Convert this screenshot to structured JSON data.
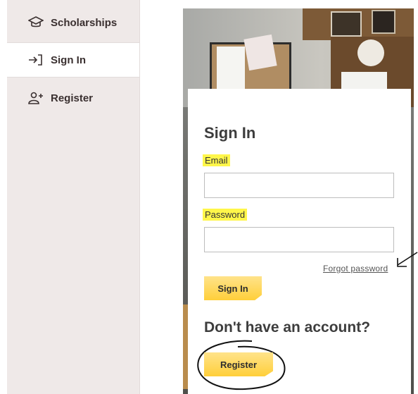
{
  "sidebar": {
    "items": [
      {
        "label": "Scholarships",
        "icon": "graduation-cap-icon"
      },
      {
        "label": "Sign In",
        "icon": "sign-in-icon",
        "active": true
      },
      {
        "label": "Register",
        "icon": "add-user-icon"
      }
    ]
  },
  "signin": {
    "title": "Sign In",
    "email_label": "Email",
    "email_value": "",
    "password_label": "Password",
    "password_value": "",
    "forgot_link": "Forgot password",
    "signin_button": "Sign In",
    "no_account_text": "Don't have an account?",
    "register_button": "Register"
  },
  "colors": {
    "highlight": "#fff64a",
    "button": "#ffcf3a",
    "sidebar_bg": "#efe9e8"
  }
}
